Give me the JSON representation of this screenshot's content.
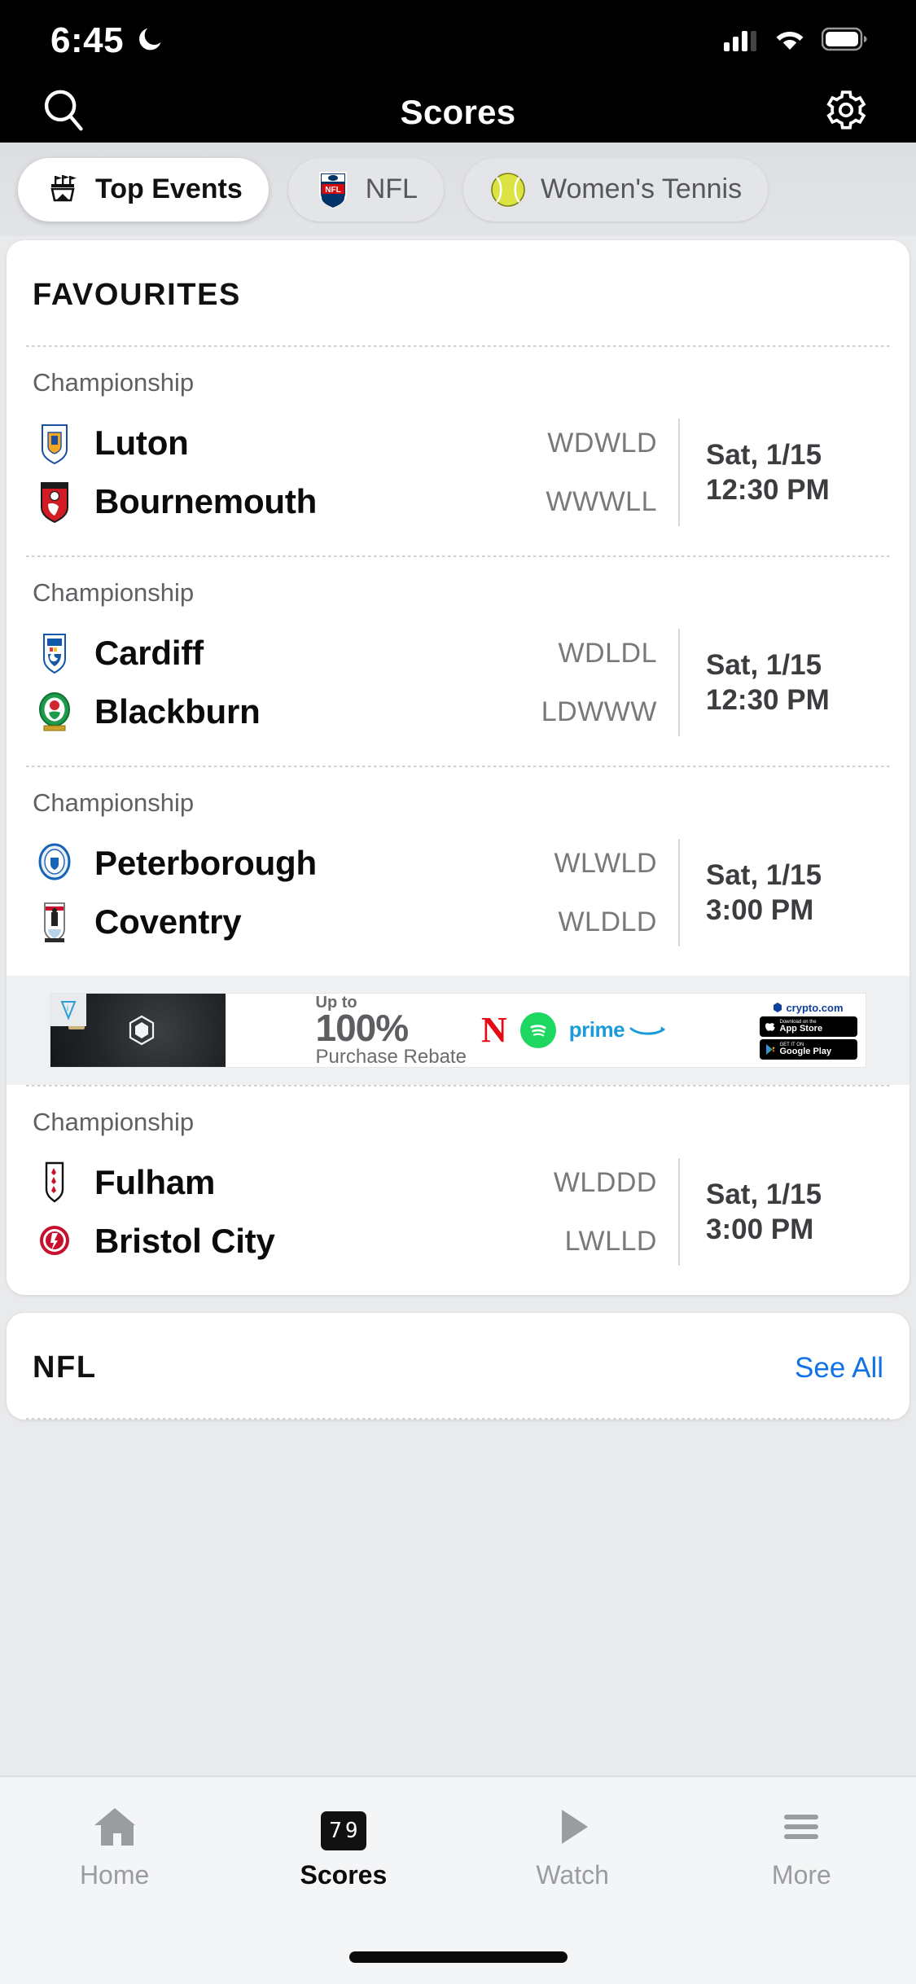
{
  "status_bar": {
    "time": "6:45",
    "icons": [
      "moon-icon",
      "cellular-signal-icon",
      "wifi-icon",
      "battery-icon"
    ]
  },
  "header": {
    "title": "Scores",
    "search_icon": "search-icon",
    "settings_icon": "gear-icon"
  },
  "tabs": [
    {
      "label": "Top Events",
      "icon": "stadium-icon",
      "active": true
    },
    {
      "label": "NFL",
      "icon": "nfl-shield-icon",
      "active": false
    },
    {
      "label": "Women's Tennis",
      "icon": "tennis-ball-icon",
      "active": false
    }
  ],
  "favourites": {
    "title": "FAVOURITES",
    "matches": [
      {
        "league": "Championship",
        "home": {
          "name": "Luton",
          "form": "WDWLD",
          "crest": "luton-town-crest"
        },
        "away": {
          "name": "Bournemouth",
          "form": "WWWLL",
          "crest": "bournemouth-crest"
        },
        "date": "Sat, 1/15",
        "time": "12:30 PM"
      },
      {
        "league": "Championship",
        "home": {
          "name": "Cardiff",
          "form": "WDLDL",
          "crest": "cardiff-city-crest"
        },
        "away": {
          "name": "Blackburn",
          "form": "LDWWW",
          "crest": "blackburn-rovers-crest"
        },
        "date": "Sat, 1/15",
        "time": "12:30 PM"
      },
      {
        "league": "Championship",
        "home": {
          "name": "Peterborough",
          "form": "WLWLD",
          "crest": "peterborough-united-crest"
        },
        "away": {
          "name": "Coventry",
          "form": "WLDLD",
          "crest": "coventry-city-crest"
        },
        "date": "Sat, 1/15",
        "time": "3:00 PM"
      },
      {
        "league": "Championship",
        "home": {
          "name": "Fulham",
          "form": "WLDDD",
          "crest": "fulham-crest"
        },
        "away": {
          "name": "Bristol City",
          "form": "LWLLD",
          "crest": "bristol-city-crest"
        },
        "date": "Sat, 1/15",
        "time": "3:00 PM"
      }
    ]
  },
  "ad": {
    "badge_icon": "ad-choices-icon",
    "up_to": "Up to",
    "percent": "100%",
    "subtitle": "Purchase Rebate",
    "brands": [
      "netflix-logo",
      "spotify-logo",
      "amazon-prime-logo"
    ],
    "advertiser": "crypto.com",
    "stores": [
      {
        "top": "Download on the",
        "name": "App Store"
      },
      {
        "top": "GET IT ON",
        "name": "Google Play"
      }
    ]
  },
  "nfl_section": {
    "title": "NFL",
    "see_all": "See All"
  },
  "bottom_nav": [
    {
      "label": "Home",
      "icon": "home-icon",
      "active": false
    },
    {
      "label": "Scores",
      "icon": "scoreboard-icon",
      "active": true
    },
    {
      "label": "Watch",
      "icon": "play-icon",
      "active": false
    },
    {
      "label": "More",
      "icon": "hamburger-icon",
      "active": false
    }
  ],
  "colors": {
    "accent_link": "#1273e6",
    "header_bg": "#000000",
    "page_bg": "#e9eaec"
  }
}
